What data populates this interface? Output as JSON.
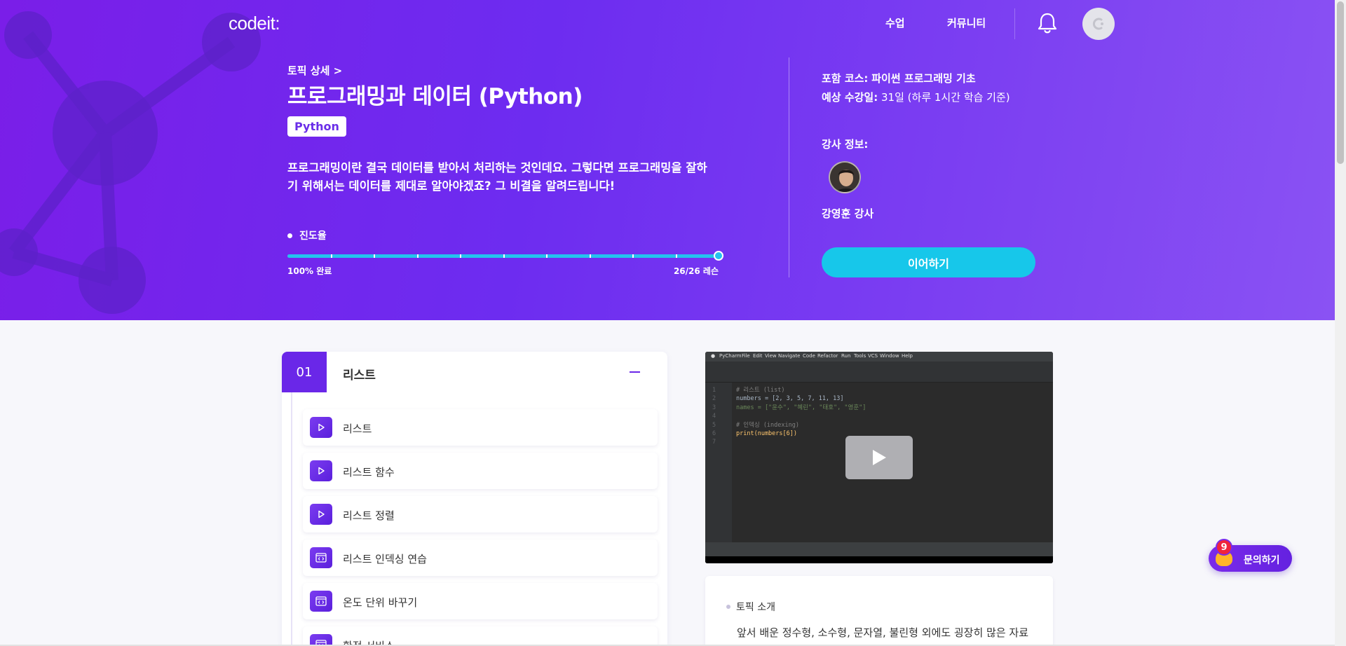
{
  "nav": {
    "logo": "codeit:",
    "links": [
      "수업",
      "커뮤니티"
    ]
  },
  "topic": {
    "breadcrumb": "토픽 상세 >",
    "title": "프로그래밍과 데이터 (Python)",
    "tag": "Python",
    "description": "프로그래밍이란 결국 데이터를 받아서 처리하는 것인데요. 그렇다면 프로그래밍을 잘하기 위해서는 데이터를 제대로 알아야겠죠? 그 비결을 알려드립니다!"
  },
  "progress": {
    "label": "진도율",
    "percent_text": "100% 완료",
    "count_text": "26/26 레슨",
    "fraction": 1.0,
    "ticks": 10
  },
  "course_info": {
    "course_label": "포함 코스:",
    "course_value": "파이썬 프로그래밍 기초",
    "duration_label": "예상 수강일:",
    "duration_value": "31일 (하루 1시간 학습 기준)",
    "instructor_label": "강사 정보:",
    "instructor_name": "강영훈 강사",
    "continue_label": "이어하기"
  },
  "chapter": {
    "number": "01",
    "title": "리스트",
    "lessons": [
      {
        "label": "리스트",
        "type": "video"
      },
      {
        "label": "리스트 함수",
        "type": "video"
      },
      {
        "label": "리스트 정렬",
        "type": "video"
      },
      {
        "label": "리스트 인덱싱 연습",
        "type": "exercise"
      },
      {
        "label": "온도 단위 바꾸기",
        "type": "exercise"
      },
      {
        "label": "환전 서비스",
        "type": "exercise"
      }
    ]
  },
  "video": {
    "menu": [
      "PyCharm",
      "File",
      "Edit",
      "View",
      "Navigate",
      "Code",
      "Refactor",
      "Run",
      "Tools",
      "VCS",
      "Window",
      "Help"
    ],
    "code_lines": [
      "# 리스트 (list)",
      "numbers = [2, 3, 5, 7, 11, 13]",
      "names = [\"윤수\", \"혜린\", \"태호\", \"영훈\"]",
      "",
      "# 인덱싱 (indexing)",
      "print(numbers[6])",
      ""
    ]
  },
  "intro": {
    "label": "토픽 소개",
    "text": "앞서 배운 정수형, 소수형, 문자열, 불린형 외에도 굉장히 많은 자료"
  },
  "help": {
    "label": "문의하기",
    "badge": "9"
  },
  "colors": {
    "brand_purple": "#6a27e8",
    "accent_cyan": "#17c7ea"
  }
}
